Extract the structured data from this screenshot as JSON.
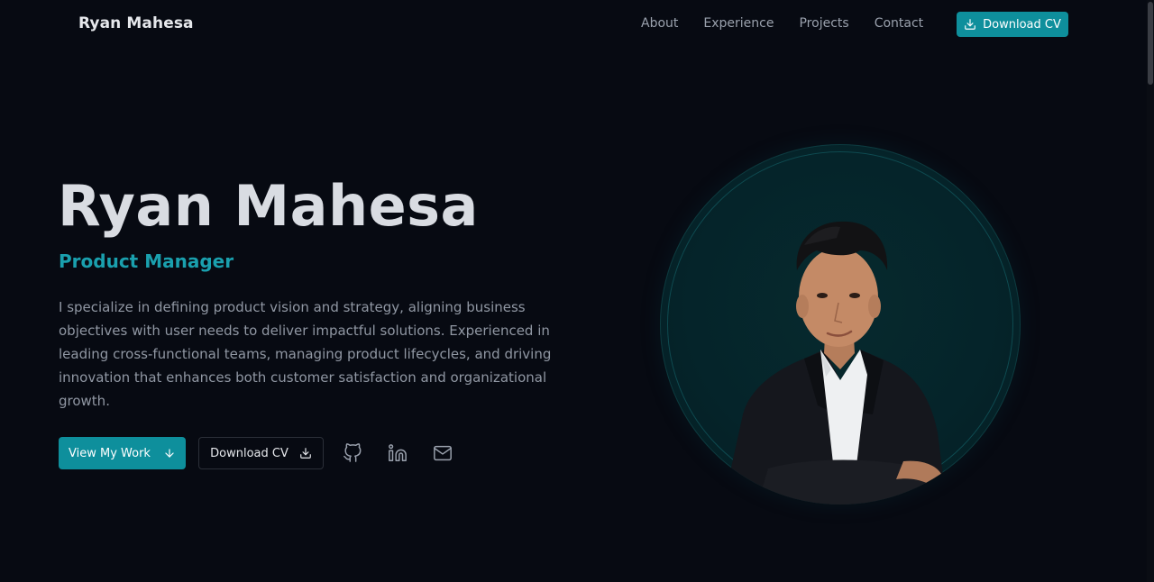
{
  "nav": {
    "brand": "Ryan Mahesa",
    "links": [
      "About",
      "Experience",
      "Projects",
      "Contact"
    ],
    "cv_label": "Download CV"
  },
  "hero": {
    "name": "Ryan Mahesa",
    "role": "Product Manager",
    "description": "I specialize in defining product vision and strategy, aligning business objectives with user needs to deliver impactful solutions. Experienced in leading cross-functional teams, managing product lifecycles, and driving innovation that enhances both customer satisfaction and organizational growth.",
    "primary_label": "View My Work",
    "secondary_label": "Download CV",
    "social_icons": [
      "github-icon",
      "linkedin-icon",
      "mail-icon"
    ]
  },
  "colors": {
    "background": "#070a12",
    "accent": "#0e8f9c",
    "accent_text": "#1aa0ae",
    "heading": "#d9dce2",
    "muted": "#9097a3"
  }
}
